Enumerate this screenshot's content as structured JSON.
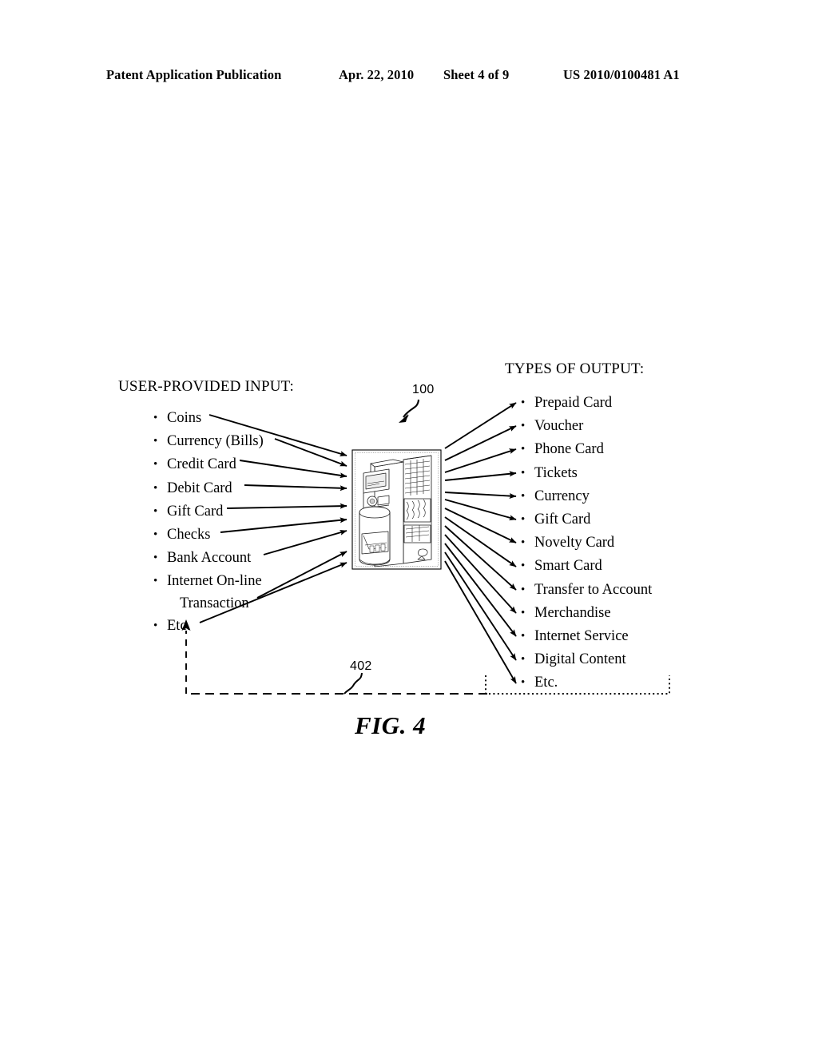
{
  "header": {
    "publication": "Patent Application Publication",
    "date": "Apr. 22, 2010",
    "sheet": "Sheet 4 of 9",
    "patent_number": "US 2010/0100481 A1"
  },
  "figure": {
    "caption": "FIG. 4",
    "input_heading": "USER-PROVIDED INPUT:",
    "output_heading": "TYPES OF OUTPUT:",
    "input_items": [
      "Coins",
      "Currency (Bills)",
      "Credit Card",
      "Debit Card",
      "Gift Card",
      "Checks",
      "Bank Account",
      "Internet On-line",
      "Etc."
    ],
    "input_item_8_continuation": "Transaction",
    "output_items": [
      "Prepaid Card",
      "Voucher",
      "Phone Card",
      "Tickets",
      "Currency",
      "Gift Card",
      "Novelty Card",
      "Smart Card",
      "Transfer to Account",
      "Merchandise",
      "Internet Service",
      "Digital Content",
      "Etc."
    ],
    "reference_numerals": {
      "kiosk": "100",
      "feedback_path": "402"
    },
    "line_color": "#000000",
    "background_color": "#ffffff"
  }
}
